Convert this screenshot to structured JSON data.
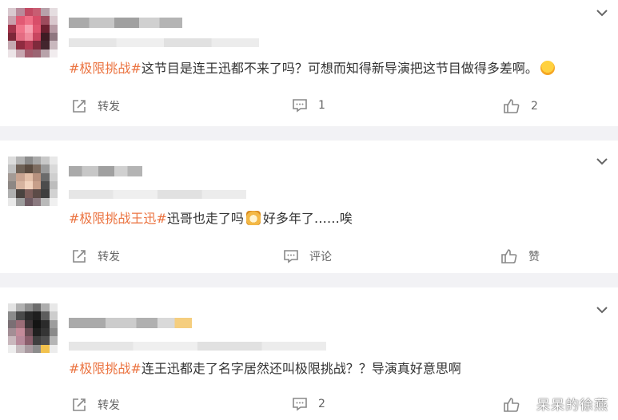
{
  "posts": [
    {
      "tag": "#极限挑战#",
      "text": "这节目是连王迅都不来了吗？可想而知得新导演把这节目做得多差啊。",
      "emoji": "hug-emoji",
      "repost_label": "转发",
      "comment_label": "1",
      "like_label": "2"
    },
    {
      "tag": "#极限挑战王迅#",
      "text_before": "迅哥也走了吗",
      "emoji": "dog-emoji",
      "text_after": "好多年了……唉",
      "repost_label": "转发",
      "comment_label": "评论",
      "like_label": "赞"
    },
    {
      "tag": "#极限挑战#",
      "text": "连王迅都走了名字居然还叫极限挑战？？导演真好意思啊",
      "repost_label": "转发",
      "comment_label": "2",
      "like_label": ""
    }
  ],
  "watermark": "呆呆的徐燕",
  "colors": {
    "tag": "#eb7340",
    "separator": "#f2f2f5",
    "icon": "#888888"
  }
}
